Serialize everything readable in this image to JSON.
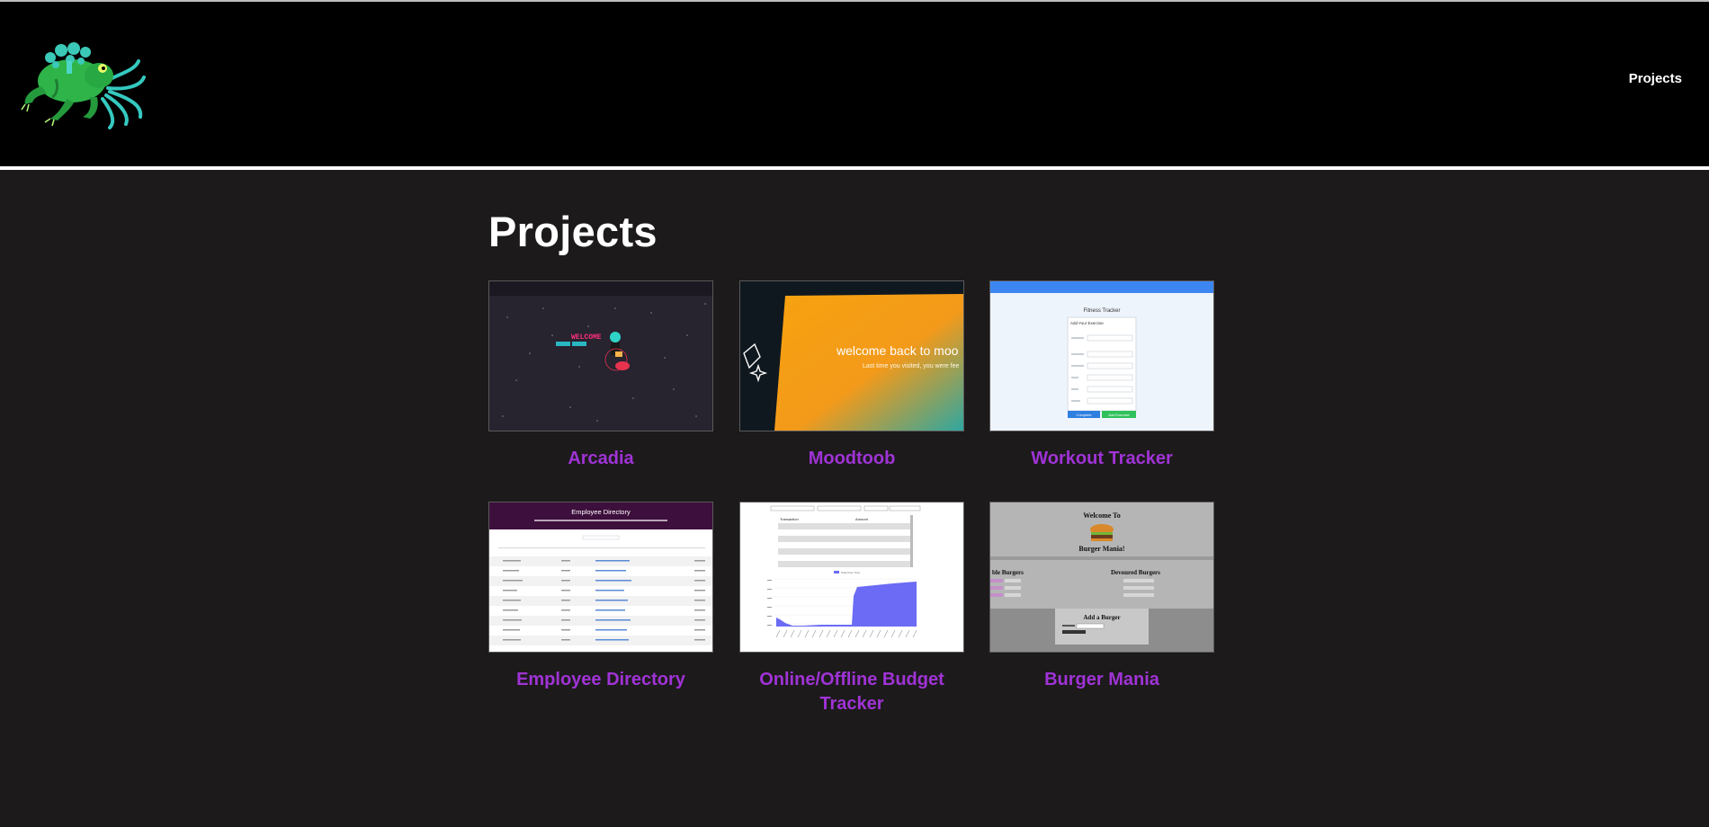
{
  "header": {
    "logo_icon": "green-octopus-frog-logo-icon",
    "nav": {
      "projects_label": "Projects"
    }
  },
  "main": {
    "title": "Projects",
    "accent_color": "#a033d6",
    "projects": [
      {
        "title": "Arcadia",
        "thumbnail": {
          "heading": "WELCOME",
          "buttons": [
            "Login",
            "Register"
          ]
        }
      },
      {
        "title": "Moodtoob",
        "thumbnail": {
          "heading": "welcome back to moo",
          "subtext": "Last time you visited, you were fee"
        }
      },
      {
        "title": "Workout Tracker",
        "thumbnail": {
          "heading": "Fitness Tracker",
          "form_title": "Add Your Exercise",
          "buttons": [
            "Complete",
            "Add Exercise"
          ]
        }
      },
      {
        "title": "Employee Directory",
        "thumbnail": {
          "heading": "Employee Directory"
        }
      },
      {
        "title": "Online/Offline Budget Tracker",
        "thumbnail": {
          "columns": [
            "Transaction",
            "Amount"
          ],
          "chart_series": "Total Over Time"
        }
      },
      {
        "title": "Burger Mania",
        "thumbnail": {
          "heading_line1": "Welcome To",
          "heading_line2": "Burger Mania!",
          "col_left": "ble Burgers",
          "col_right": "Devoured Burgers",
          "form_title": "Add a Burger"
        }
      }
    ]
  }
}
